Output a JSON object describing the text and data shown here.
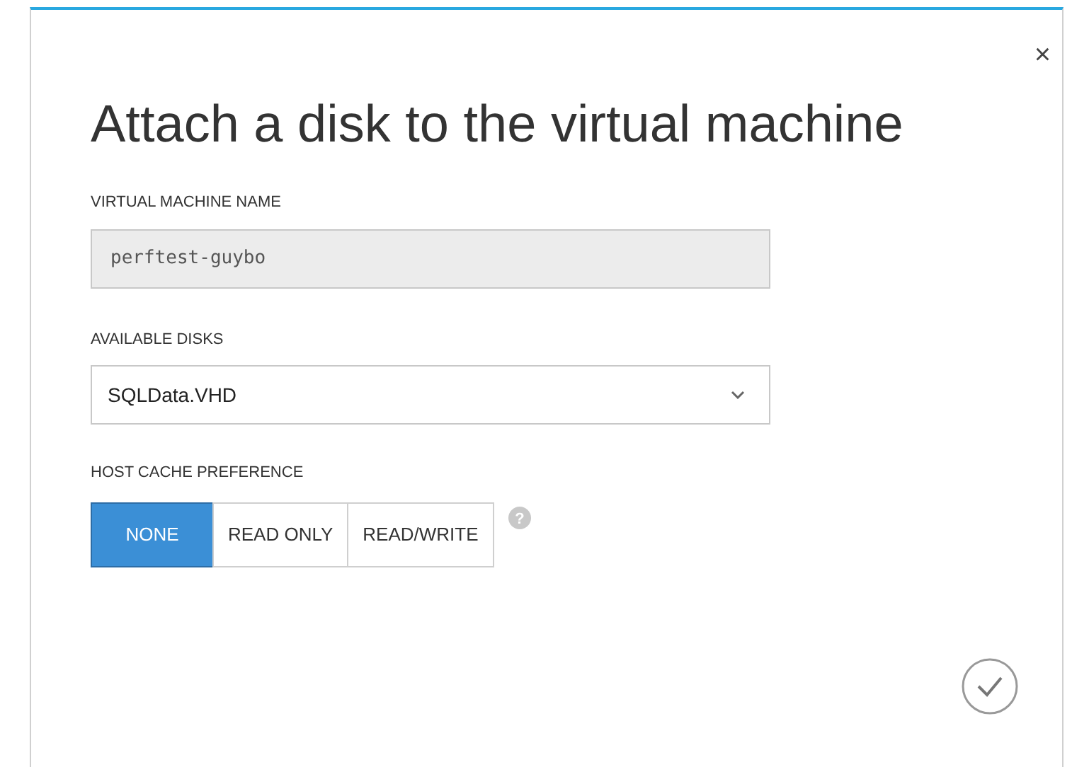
{
  "dialog": {
    "title": "Attach a disk to the virtual machine",
    "close": "×"
  },
  "vm_name": {
    "label": "VIRTUAL MACHINE NAME",
    "value": "perftest-guybo",
    "disabled": true
  },
  "available_disks": {
    "label": "AVAILABLE DISKS",
    "value": "SQLData.VHD"
  },
  "host_cache": {
    "label": "HOST CACHE PREFERENCE",
    "help": "?",
    "options": [
      {
        "label": "NONE",
        "selected": true
      },
      {
        "label": "READ ONLY",
        "selected": false
      },
      {
        "label": "READ/WRITE",
        "selected": false
      }
    ]
  }
}
